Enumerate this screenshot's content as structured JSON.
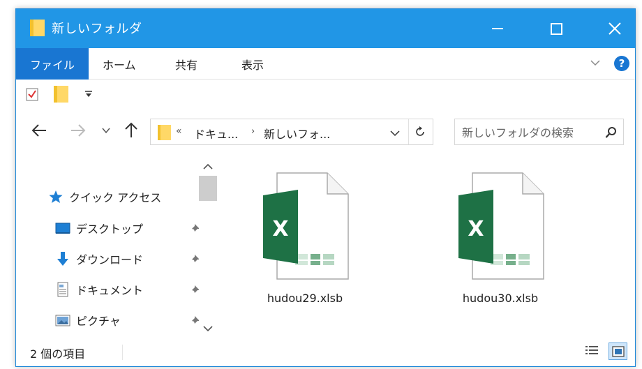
{
  "window": {
    "title": "新しいフォルダ",
    "accent_color": "#2196e6"
  },
  "ribbon": {
    "tabs": [
      {
        "label": "ファイル",
        "active": true
      },
      {
        "label": "ホーム"
      },
      {
        "label": "共有"
      },
      {
        "label": "表示"
      }
    ],
    "help_label": "?"
  },
  "address": {
    "overflow": "«",
    "crumbs": [
      "ドキュ...",
      "新しいフォ..."
    ],
    "separator": "›"
  },
  "search": {
    "placeholder": "新しいフォルダの検索"
  },
  "nav": {
    "items": [
      {
        "label": "クイック アクセス",
        "icon": "star-icon"
      },
      {
        "label": "デスクトップ",
        "icon": "desktop-icon",
        "pinned": true
      },
      {
        "label": "ダウンロード",
        "icon": "download-arrow-icon",
        "pinned": true
      },
      {
        "label": "ドキュメント",
        "icon": "document-icon",
        "pinned": true
      },
      {
        "label": "ピクチャ",
        "icon": "picture-icon",
        "pinned": true
      }
    ]
  },
  "files": [
    {
      "name": "hudou29.xlsb",
      "icon": "excel-file-icon"
    },
    {
      "name": "hudou30.xlsb",
      "icon": "excel-file-icon"
    }
  ],
  "excel_icon": {
    "letter": "X",
    "color": "#1e7145"
  },
  "status": {
    "item_count": "2 個の項目"
  }
}
